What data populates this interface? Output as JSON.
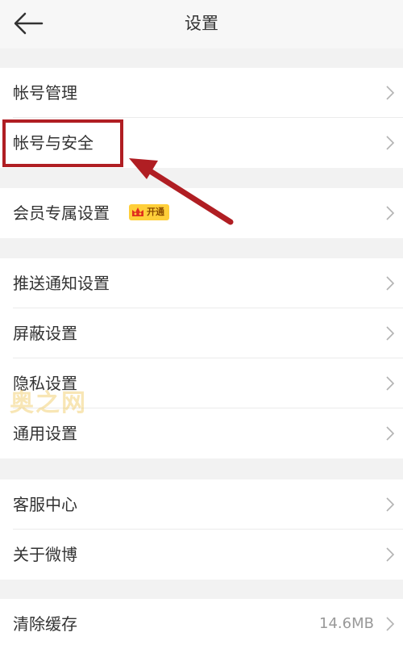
{
  "header": {
    "title": "设置",
    "back_icon": "back-arrow-icon"
  },
  "groups": [
    {
      "items": [
        {
          "label": "帐号管理"
        },
        {
          "label": "帐号与安全"
        }
      ]
    },
    {
      "items": [
        {
          "label": "会员专属设置",
          "badge": "开通"
        }
      ]
    },
    {
      "items": [
        {
          "label": "推送通知设置"
        },
        {
          "label": "屏蔽设置"
        },
        {
          "label": "隐私设置"
        },
        {
          "label": "通用设置"
        }
      ]
    },
    {
      "items": [
        {
          "label": "客服中心"
        },
        {
          "label": "关于微博"
        }
      ]
    },
    {
      "items": [
        {
          "label": "清除缓存",
          "value": "14.6MB"
        }
      ]
    }
  ],
  "watermark": "奥之网",
  "colors": {
    "annotation": "#b01e23",
    "background": "#f2f2f2",
    "vip_badge": "#ffcf3a"
  }
}
